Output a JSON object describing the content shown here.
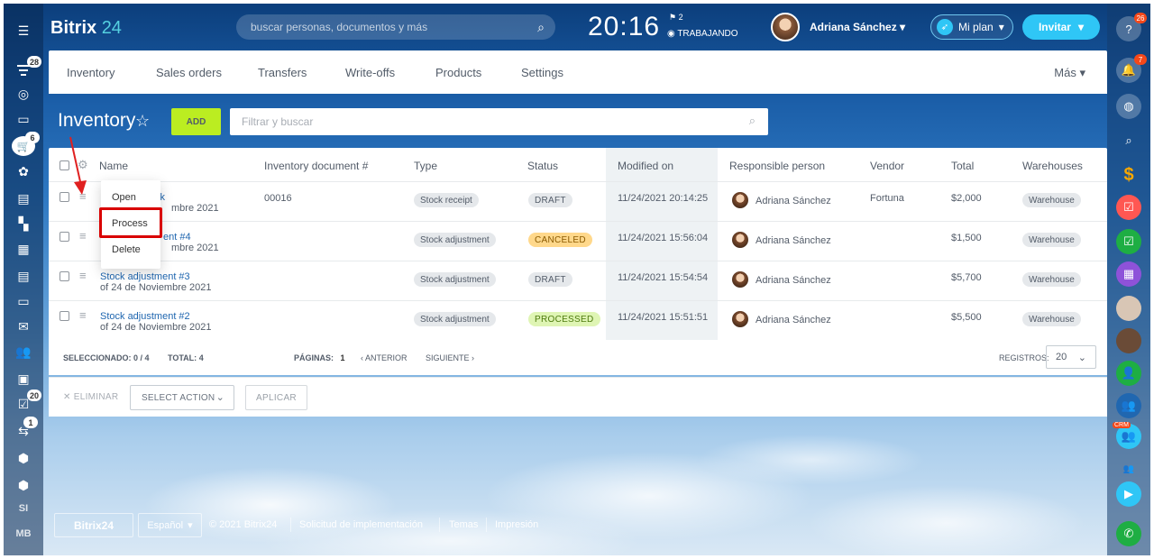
{
  "header": {
    "logo_text": "Bitrix",
    "logo_num": "24",
    "search_placeholder": "buscar personas, documentos y más",
    "clock": "20:16",
    "clock_flag": "2",
    "work_status": "TRABAJANDO",
    "user_name": "Adriana Sánchez",
    "plan_label": "Mi plan",
    "invite_label": "Invitar"
  },
  "left_sidebar": {
    "badges": {
      "feed": "28",
      "shop": "6",
      "tasks": "20",
      "workflow": "1"
    },
    "texts": {
      "si": "SI",
      "mb": "MB"
    }
  },
  "right_sidebar": {
    "badges": {
      "help": "26",
      "notifications": "7"
    },
    "crm_label": "CRM"
  },
  "nav": {
    "items": [
      "Inventory",
      "Sales orders",
      "Transfers",
      "Write-offs",
      "Products",
      "Settings"
    ],
    "more": "Más"
  },
  "page": {
    "title": "Inventory",
    "add_label": "ADD",
    "filter_placeholder": "Filtrar y buscar"
  },
  "grid": {
    "columns": [
      "Name",
      "Inventory document #",
      "Type",
      "Status",
      "Modified on",
      "Responsible person",
      "Vendor",
      "Total",
      "Warehouses"
    ],
    "rows": [
      {
        "name": "ck",
        "date": "mbre 2021",
        "doc_no": "00016",
        "type": "Stock receipt",
        "status": "DRAFT",
        "modified": "11/24/2021 20:14:25",
        "person": "Adriana Sánchez",
        "vendor": "Fortuna",
        "total": "$2,000",
        "warehouse": "Warehouse"
      },
      {
        "name": "ent #4",
        "date": "mbre 2021",
        "doc_no": "",
        "type": "Stock adjustment",
        "status": "CANCELED",
        "modified": "11/24/2021 15:56:04",
        "person": "Adriana Sánchez",
        "vendor": "",
        "total": "$1,500",
        "warehouse": "Warehouse"
      },
      {
        "name": "Stock adjustment #3",
        "date": "of 24 de Noviembre 2021",
        "doc_no": "",
        "type": "Stock adjustment",
        "status": "DRAFT",
        "modified": "11/24/2021 15:54:54",
        "person": "Adriana Sánchez",
        "vendor": "",
        "total": "$5,700",
        "warehouse": "Warehouse"
      },
      {
        "name": "Stock adjustment #2",
        "date": "of 24 de Noviembre 2021",
        "doc_no": "",
        "type": "Stock adjustment",
        "status": "PROCESSED",
        "modified": "11/24/2021 15:51:51",
        "person": "Adriana Sánchez",
        "vendor": "",
        "total": "$5,500",
        "warehouse": "Warehouse"
      }
    ],
    "footer": {
      "selected_label": "SELECCIONADO:",
      "selected_value": "0 / 4",
      "total_label": "TOTAL:",
      "total_value": "4",
      "pages_label": "PÁGINAS:",
      "pages_value": "1",
      "prev": "ANTERIOR",
      "next": "SIGUIENTE",
      "registros_label": "REGISTROS:",
      "registros_value": "20"
    }
  },
  "actions": {
    "delete": "ELIMINAR",
    "select_action": "SELECT ACTION",
    "apply": "APLICAR"
  },
  "context_menu": {
    "items": [
      "Open",
      "Process",
      "Delete"
    ],
    "highlighted": "Process"
  },
  "footer": {
    "logo": "Bitrix24",
    "language": "Español",
    "copyright": "© 2021 Bitrix24",
    "implementation": "Solicitud de implementación",
    "themes": "Temas",
    "print": "Impresión"
  },
  "colors": {
    "accent": "#2fc6f6",
    "add_button": "#bbed21",
    "status_draft_bg": "#e5e8eb",
    "status_canceled_bg": "#ffd88b",
    "status_processed_bg": "#dff5b4",
    "highlight": "#d90000"
  }
}
